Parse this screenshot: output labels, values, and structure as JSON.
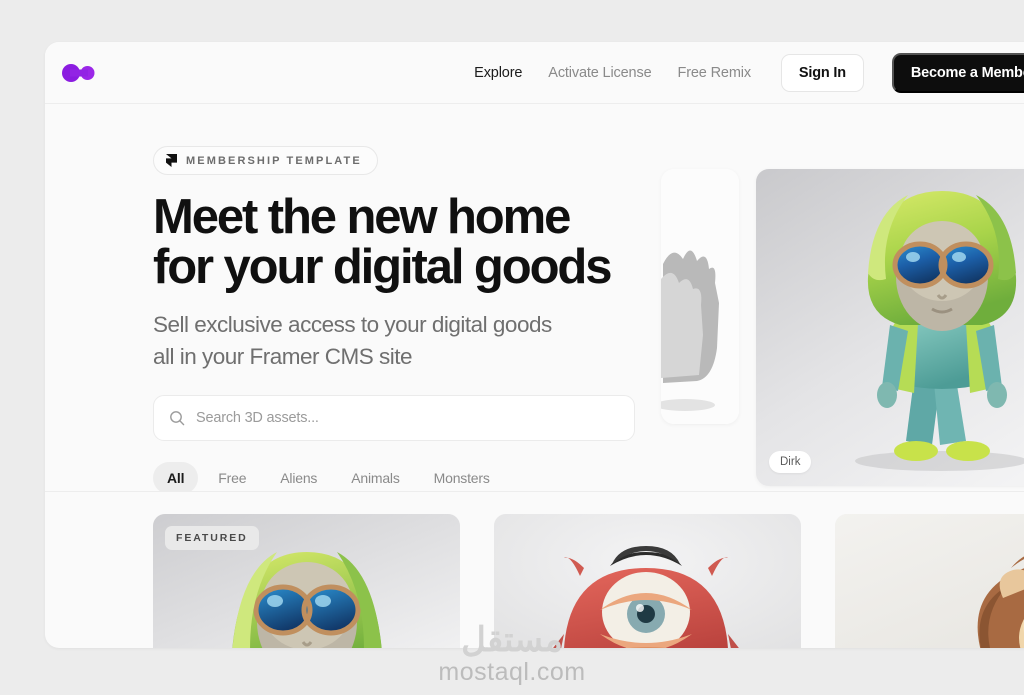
{
  "header": {
    "logo_icon": "framer-membership-logo",
    "logo_color": "#8b1ce0",
    "nav": [
      {
        "label": "Explore",
        "active": true
      },
      {
        "label": "Activate License",
        "active": false
      },
      {
        "label": "Free Remix",
        "active": false
      }
    ],
    "sign_in_label": "Sign In",
    "member_label": "Become a Member"
  },
  "hero": {
    "badge": {
      "icon": "framer-icon",
      "label": "MEMBERSHIP TEMPLATE"
    },
    "headline_line1": "Meet the new home",
    "headline_line2": "for your digital goods",
    "sub_line1": "Sell exclusive access to your digital goods",
    "sub_line2": "all in your Framer CMS site",
    "search": {
      "icon": "search-icon",
      "placeholder": "Search 3D assets...",
      "value": ""
    },
    "chips": [
      {
        "label": "All",
        "active": true
      },
      {
        "label": "Free",
        "active": false
      },
      {
        "label": "Aliens",
        "active": false
      },
      {
        "label": "Animals",
        "active": false
      },
      {
        "label": "Monsters",
        "active": false
      }
    ],
    "carousel": {
      "prev_card_alt": "gray furry creature",
      "main_card_alt": "alien character in green hoodie with blue goggles",
      "main_card_name": "Dirk"
    }
  },
  "grid": {
    "featured_label": "FEATURED",
    "cards": [
      {
        "alt": "alien in green hoodie",
        "featured": true
      },
      {
        "alt": "red furry one-eyed monster",
        "featured": false
      },
      {
        "alt": "cartoon lion with brown mane",
        "featured": false
      }
    ]
  },
  "watermark": {
    "arabic": "مستقل",
    "latin": "mostaql.com"
  }
}
